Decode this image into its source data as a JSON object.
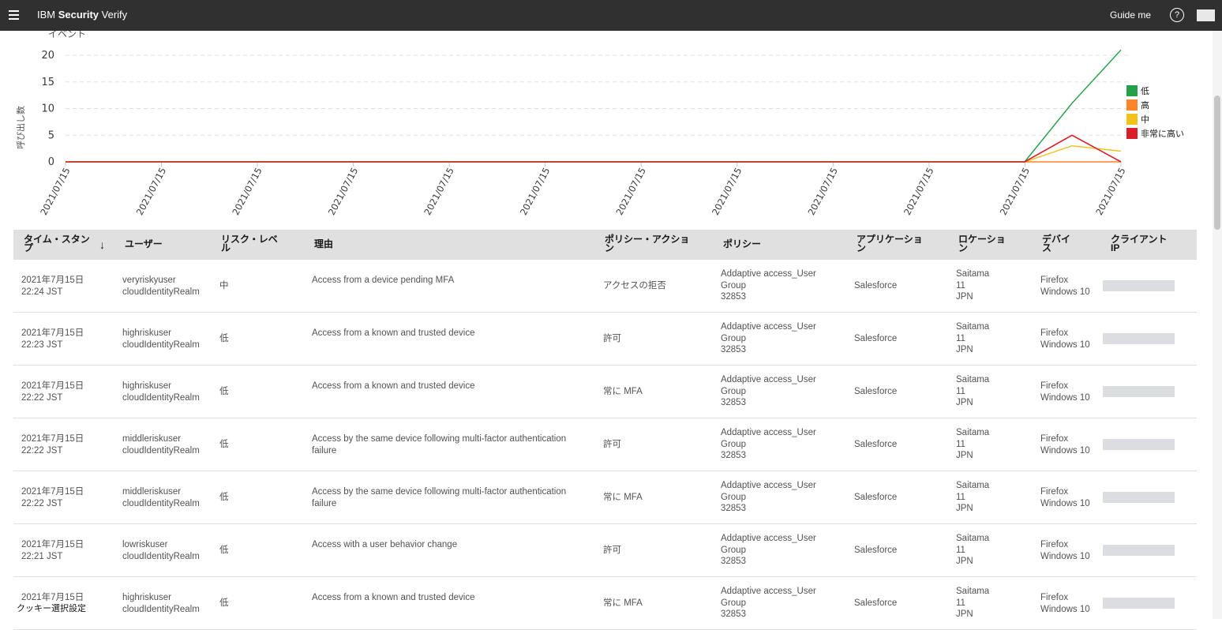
{
  "app": {
    "brand_prefix": "IBM ",
    "brand_bold": "Security",
    "brand_suffix": " Verify",
    "guide_me": "Guide me",
    "help_glyph": "?"
  },
  "chart_data": {
    "type": "line",
    "title": "イベント",
    "ylabel": "呼び出し数",
    "xlabel": "",
    "ylim": [
      0,
      21
    ],
    "yticks": [
      0,
      5,
      10,
      15,
      20
    ],
    "x": [
      "2021/07/15",
      "2021/07/15",
      "2021/07/15",
      "2021/07/15",
      "2021/07/15",
      "2021/07/15",
      "2021/07/15",
      "2021/07/15",
      "2021/07/15",
      "2021/07/15",
      "2021/07/15",
      "2021/07/15",
      "2021/07/15"
    ],
    "tick_labels": [
      "2021/07/15",
      "2021/07/15",
      "2021/07/15",
      "2021/07/15",
      "2021/07/15",
      "2021/07/15",
      "2021/07/15",
      "2021/07/15",
      "2021/07/15",
      "2021/07/15",
      "2021/07/15",
      "2021/07/15"
    ],
    "grid": true,
    "legend_position": "right",
    "series": [
      {
        "name": "低",
        "color": "#24a148",
        "values": [
          0,
          0,
          0,
          0,
          0,
          0,
          0,
          0,
          0,
          0,
          0,
          11,
          21
        ]
      },
      {
        "name": "高",
        "color": "#ff832b",
        "values": [
          0,
          0,
          0,
          0,
          0,
          0,
          0,
          0,
          0,
          0,
          0,
          0,
          0
        ]
      },
      {
        "name": "中",
        "color": "#f1c21b",
        "values": [
          0,
          0,
          0,
          0,
          0,
          0,
          0,
          0,
          0,
          0,
          0,
          3,
          2
        ]
      },
      {
        "name": "非常に高い",
        "color": "#da1e28",
        "values": [
          0,
          0,
          0,
          0,
          0,
          0,
          0,
          0,
          0,
          0,
          0,
          5,
          0
        ]
      }
    ]
  },
  "table": {
    "headers": {
      "timestamp": [
        "タイム・スタン",
        "プ"
      ],
      "user": "ユーザー",
      "risk": [
        "リスク・レベ",
        "ル"
      ],
      "reason": "理由",
      "action": [
        "ポリシー・アクショ",
        "ン"
      ],
      "policy": "ポリシー",
      "application": [
        "アプリケーショ",
        "ン"
      ],
      "location": [
        "ロケーショ",
        "ン"
      ],
      "device": [
        "デバイ",
        "ス"
      ],
      "client_ip": [
        "クライアント",
        "IP"
      ]
    },
    "sort_icon": "↓",
    "rows": [
      {
        "date": "2021年7月15日",
        "time": "22:24 JST",
        "user": "veryriskyuser",
        "realm": "cloudIdentityRealm",
        "risk": "中",
        "reason1": "Access from a device pending MFA",
        "reason2": "",
        "action": "アクセスの拒否",
        "policy1": "Addaptive access_User",
        "policy2": "Group",
        "policy3": "32853",
        "app": "Salesforce",
        "loc1": "Saitama",
        "loc2": "11",
        "loc3": "JPN",
        "dev1": "Firefox",
        "dev2": "Windows 10"
      },
      {
        "date": "2021年7月15日",
        "time": "22:23 JST",
        "user": "highriskuser",
        "realm": "cloudIdentityRealm",
        "risk": "低",
        "reason1": "Access from a known and trusted device",
        "reason2": "",
        "action": "許可",
        "policy1": "Addaptive access_User",
        "policy2": "Group",
        "policy3": "32853",
        "app": "Salesforce",
        "loc1": "Saitama",
        "loc2": "11",
        "loc3": "JPN",
        "dev1": "Firefox",
        "dev2": "Windows 10"
      },
      {
        "date": "2021年7月15日",
        "time": "22:22 JST",
        "user": "highriskuser",
        "realm": "cloudIdentityRealm",
        "risk": "低",
        "reason1": "Access from a known and trusted device",
        "reason2": "",
        "action": "常に MFA",
        "policy1": "Addaptive access_User",
        "policy2": "Group",
        "policy3": "32853",
        "app": "Salesforce",
        "loc1": "Saitama",
        "loc2": "11",
        "loc3": "JPN",
        "dev1": "Firefox",
        "dev2": "Windows 10"
      },
      {
        "date": "2021年7月15日",
        "time": "22:22 JST",
        "user": "middleriskuser",
        "realm": "cloudIdentityRealm",
        "risk": "低",
        "reason1": "Access by the same device following multi-factor authentication",
        "reason2": "failure",
        "action": "許可",
        "policy1": "Addaptive access_User",
        "policy2": "Group",
        "policy3": "32853",
        "app": "Salesforce",
        "loc1": "Saitama",
        "loc2": "11",
        "loc3": "JPN",
        "dev1": "Firefox",
        "dev2": "Windows 10"
      },
      {
        "date": "2021年7月15日",
        "time": "22:22 JST",
        "user": "middleriskuser",
        "realm": "cloudIdentityRealm",
        "risk": "低",
        "reason1": "Access by the same device following multi-factor authentication",
        "reason2": "failure",
        "action": "常に MFA",
        "policy1": "Addaptive access_User",
        "policy2": "Group",
        "policy3": "32853",
        "app": "Salesforce",
        "loc1": "Saitama",
        "loc2": "11",
        "loc3": "JPN",
        "dev1": "Firefox",
        "dev2": "Windows 10"
      },
      {
        "date": "2021年7月15日",
        "time": "22:21 JST",
        "user": "lowriskuser",
        "realm": "cloudIdentityRealm",
        "risk": "低",
        "reason1": "Access with a user behavior change",
        "reason2": "",
        "action": "許可",
        "policy1": "Addaptive access_User",
        "policy2": "Group",
        "policy3": "32853",
        "app": "Salesforce",
        "loc1": "Saitama",
        "loc2": "11",
        "loc3": "JPN",
        "dev1": "Firefox",
        "dev2": "Windows 10"
      },
      {
        "date": "2021年7月15日",
        "time": "",
        "user": "highriskuser",
        "realm": "cloudIdentityRealm",
        "risk": "低",
        "reason1": "Access from a known and trusted device",
        "reason2": "",
        "action": "常に MFA",
        "policy1": "Addaptive access_User",
        "policy2": "Group",
        "policy3": "32853",
        "app": "Salesforce",
        "loc1": "Saitama",
        "loc2": "11",
        "loc3": "JPN",
        "dev1": "Firefox",
        "dev2": "Windows 10"
      }
    ]
  },
  "footer": {
    "cookie_settings": "クッキー選択設定"
  }
}
